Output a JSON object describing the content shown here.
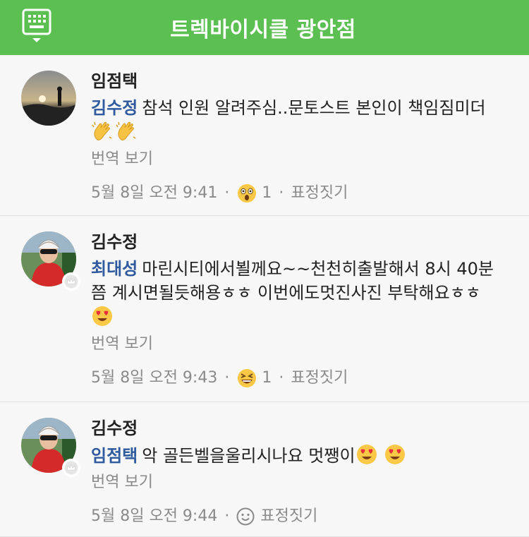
{
  "header": {
    "title": "트렉바이시클 광안점"
  },
  "comments": [
    {
      "author": "임점택",
      "mention": "김수정",
      "text": "참석 인원 알려주심..문토스트 본인이 책임짐미더",
      "translate": "번역 보기",
      "time": "5월 8일 오전 9:41",
      "reaction_count": "1",
      "react_label": "표정짓기"
    },
    {
      "author": "김수정",
      "mention": "최대성",
      "text": "마린시티에서뵐께요~~천천히출발해서 8시 40분쯤 계시면될듯해용ㅎㅎ 이번에도멋진사진 부탁해요ㅎㅎ",
      "translate": "번역 보기",
      "time": "5월 8일 오전 9:43",
      "reaction_count": "1",
      "react_label": "표정짓기"
    },
    {
      "author": "김수정",
      "mention": "임점택",
      "text": "악 골든벨을울리시나요 멋쨍이",
      "translate": "번역 보기",
      "time": "5월 8일 오전 9:44",
      "react_label": "표정짓기"
    }
  ],
  "separator": "·",
  "colors": {
    "header": "#5cbf52",
    "mention": "#2f5a9e",
    "meta": "#8a8a8a"
  }
}
